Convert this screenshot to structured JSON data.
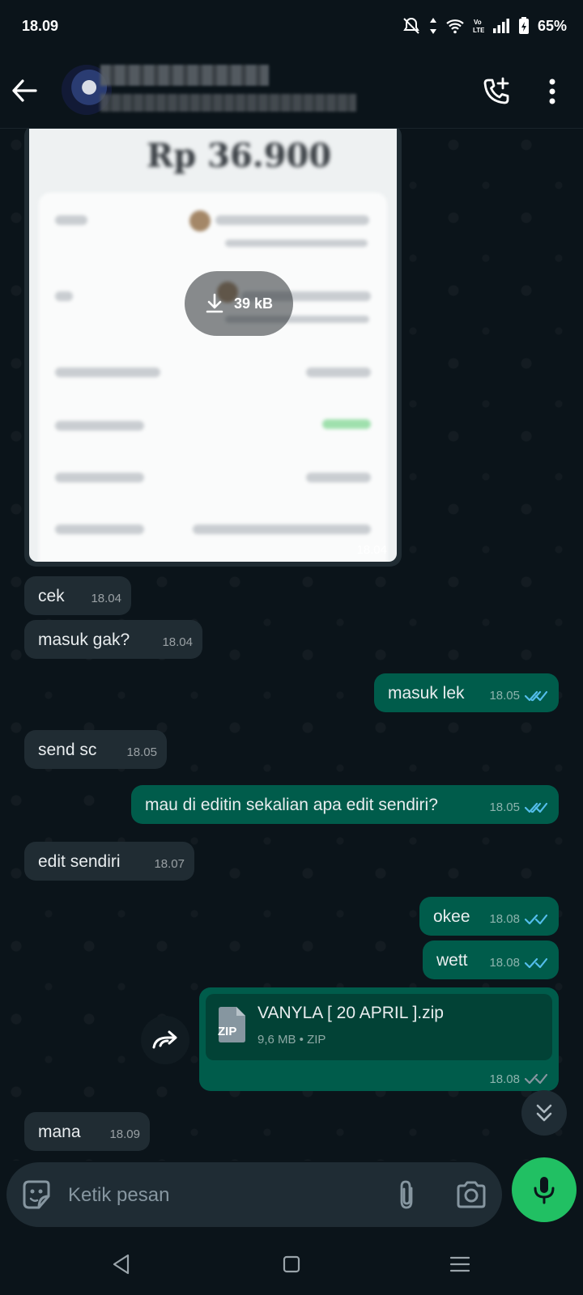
{
  "status_bar": {
    "time": "18.09",
    "battery": "65%",
    "network_label": "Vo LTE"
  },
  "header": {
    "back_icon": "arrow-left-icon",
    "call_icon": "add-call-icon",
    "more_icon": "more-vert-icon"
  },
  "image_message": {
    "amount": "Rp 36.900",
    "download_size": "39 kB",
    "time": "18.04"
  },
  "messages": [
    {
      "text": "cek",
      "time": "18.04",
      "dir": "in"
    },
    {
      "text": "masuk gak?",
      "time": "18.04",
      "dir": "in"
    },
    {
      "text": "masuk lek",
      "time": "18.05",
      "dir": "out"
    },
    {
      "text": "send sc",
      "time": "18.05",
      "dir": "in"
    },
    {
      "text": "mau di editin sekalian apa edit sendiri?",
      "time": "18.05",
      "dir": "out"
    },
    {
      "text": "edit sendiri",
      "time": "18.07",
      "dir": "in"
    },
    {
      "text": "okee",
      "time": "18.08",
      "dir": "out"
    },
    {
      "text": "wett",
      "time": "18.08",
      "dir": "out"
    },
    {
      "text": "mana",
      "time": "18.09",
      "dir": "in"
    }
  ],
  "file_message": {
    "name": "VANYLA [ 20 APRIL ].zip",
    "info": "9,6 MB • ZIP",
    "icon_label": "ZIP",
    "time": "18.08"
  },
  "composer": {
    "placeholder": "Ketik pesan"
  },
  "colors": {
    "incoming": "#202c33",
    "outgoing": "#005c4b",
    "accent": "#21c063",
    "read_tick": "#53bdeb"
  }
}
